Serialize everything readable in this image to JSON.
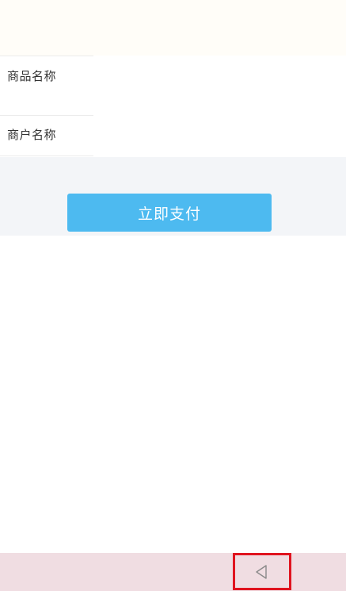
{
  "info": {
    "product_name_label": "商品名称",
    "merchant_name_label": "商户名称"
  },
  "payment": {
    "pay_button_label": "立即支付",
    "accent_color": "#4dbaf0"
  },
  "nav": {
    "back_icon": "back-triangle-icon",
    "highlight_color": "#e0141f"
  }
}
